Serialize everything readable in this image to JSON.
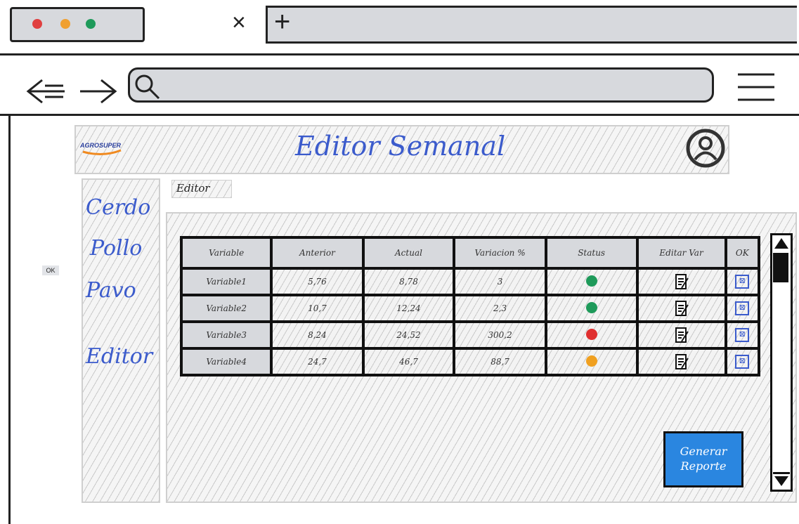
{
  "browser": {
    "close_tab_glyph": "×",
    "new_tab_glyph": "+",
    "back_icon": "arrow-left-icon",
    "forward_icon": "arrow-right-icon",
    "search_icon": "search-icon",
    "menu_icon": "hamburger-menu-icon",
    "dots": [
      "#e04040",
      "#f0a030",
      "#1e9a5a"
    ]
  },
  "header": {
    "logo_text": "AGROSUPER",
    "title": "Editor Semanal",
    "avatar_icon": "user-avatar-icon"
  },
  "sidebar": {
    "items": [
      {
        "label": "Cerdo"
      },
      {
        "label": "Pollo"
      },
      {
        "label": "Pavo"
      },
      {
        "label": "Editor"
      }
    ]
  },
  "floating_ok": "OK",
  "breadcrumb": "Editor",
  "table": {
    "headers": [
      "Variable",
      "Anterior",
      "Actual",
      "Variacion %",
      "Status",
      "Editar Var",
      "OK"
    ],
    "rows": [
      {
        "variable": "Variable1",
        "anterior": "5,76",
        "actual": "8,78",
        "variacion": "3",
        "status": "green"
      },
      {
        "variable": "Variable2",
        "anterior": "10,7",
        "actual": "12,24",
        "variacion": "2,3",
        "status": "green"
      },
      {
        "variable": "Variable3",
        "anterior": "8,24",
        "actual": "24,52",
        "variacion": "300,2",
        "status": "red"
      },
      {
        "variable": "Variable4",
        "anterior": "24,7",
        "actual": "46,7",
        "variacion": "88,7",
        "status": "orange"
      }
    ],
    "status_colors": {
      "green": "#1e9a5a",
      "red": "#e03030",
      "orange": "#f0a020"
    }
  },
  "report_button": {
    "label": "Generar Reporte"
  },
  "accent": "#3b5bcc",
  "button_color": "#2a86e0"
}
